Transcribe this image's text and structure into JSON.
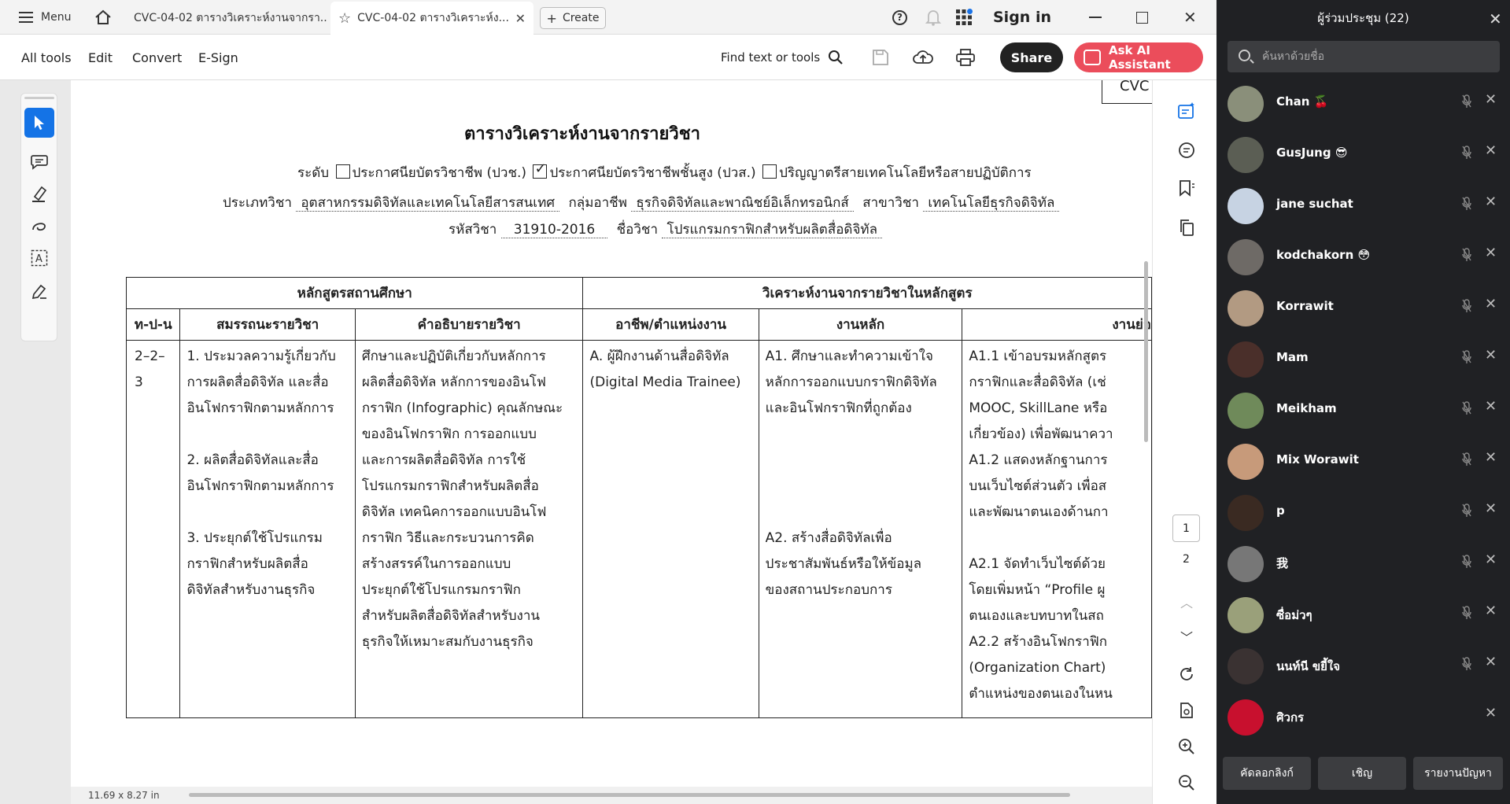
{
  "tabbar": {
    "menu_label": "Menu",
    "tabs": [
      {
        "label": "CVC-04-02 ตารางวิเคราะห์งานจากรา..."
      },
      {
        "label": "CVC-04-02 ตารางวิเคราะห์ง..."
      }
    ],
    "create_label": "Create",
    "sign_in_label": "Sign in"
  },
  "toolbar": {
    "all_tools": "All tools",
    "edit": "Edit",
    "convert": "Convert",
    "esign": "E-Sign",
    "find_label": "Find text or tools",
    "share_label": "Share",
    "ai_label": "Ask AI Assistant"
  },
  "document": {
    "corner_label": "CVC",
    "title": "ตารางวิเคราะห์งานจากรายวิชา",
    "level_label": "ระดับ",
    "level_options": [
      {
        "label": "ประกาศนียบัตรวิชาชีพ (ปวช.)",
        "checked": false
      },
      {
        "label": "ประกาศนียบัตรวิชาชีพชั้นสูง (ปวส.)",
        "checked": true
      },
      {
        "label": "ปริญญาตรีสายเทคโนโลยีหรือสายปฏิบัติการ",
        "checked": false
      }
    ],
    "type_label": "ประเภทวิชา",
    "type_value": "อุตสาหกรรมดิจิทัลและเทคโนโลยีสารสนเทศ",
    "group_label": "กลุ่มอาชีพ",
    "group_value": "ธุรกิจดิจิทัลและพาณิชย์อิเล็กทรอนิกส์",
    "major_label": "สาขาวิชา",
    "major_value": "เทคโนโลยีธุรกิจดิจิทัล",
    "code_label": "รหัสวิชา",
    "code_value": "31910-2016",
    "subject_label": "ชื่อวิชา",
    "subject_value": "โปรแกรมกราฟิกสำหรับผลิตสื่อดิจิทัล",
    "table": {
      "group_left": "หลักสูตรสถานศึกษา",
      "group_right": "วิเคราะห์งานจากรายวิชาในหลักสูตร",
      "headers": [
        "ท-ป-น",
        "สมรรถนะรายวิชา",
        "คำอธิบายรายวิชา",
        "อาชีพ/ตำแหน่งงาน",
        "งานหลัก",
        "งานย่อ"
      ],
      "tpn": "2–2–3",
      "competencies": [
        [
          "1. ประมวลความรู้เกี่ยวกับ",
          "การผลิตสื่อดิจิทัล และสื่อ",
          "อินโฟกราฟิกตามหลักการ"
        ],
        [
          "2. ผลิตสื่อดิจิทัลและสื่อ",
          "อินโฟกราฟิกตามหลักการ"
        ],
        [
          "3. ประยุกต์ใช้โปรแกรม",
          "กราฟิกสำหรับผลิตสื่อ",
          "ดิจิทัลสำหรับงานธุรกิจ"
        ]
      ],
      "description": [
        "ศึกษาและปฏิบัติเกี่ยวกับหลักการ",
        "ผลิตสื่อดิจิทัล หลักการของอินโฟ",
        "กราฟิก (Infographic) คุณลักษณะ",
        "ของอินโฟกราฟิก การออกแบบ",
        "และการผลิตสื่อดิจิทัล การใช้",
        "โปรแกรมกราฟิกสำหรับผลิตสื่อ",
        "ดิจิทัล เทคนิคการออกแบบอินโฟ",
        "กราฟิก วิธีและกระบวนการคิด",
        "สร้างสรรค์ในการออกแบบ",
        "ประยุกต์ใช้โปรแกรมกราฟิก",
        "สำหรับผลิตสื่อดิจิทัลสำหรับงาน",
        "ธุรกิจให้เหมาะสมกับงานธุรกิจ"
      ],
      "occupation": [
        "A. ผู้ฝึกงานด้านสื่อดิจิทัล",
        "(Digital Media Trainee)"
      ],
      "main_tasks": [
        [
          "A1. ศึกษาและทำความเข้าใจ",
          "หลักการออกแบบกราฟิกดิจิทัล",
          "และอินโฟกราฟิกที่ถูกต้อง"
        ],
        [
          "A2. สร้างสื่อดิจิทัลเพื่อ",
          "ประชาสัมพันธ์หรือให้ข้อมูล",
          "ของสถานประกอบการ"
        ]
      ],
      "sub_tasks": [
        "A1.1 เข้าอบรมหลักสูตร",
        "กราฟิกและสื่อดิจิทัล (เช่",
        "MOOC, SkillLane หรือ",
        "เกี่ยวข้อง) เพื่อพัฒนาควา",
        "A1.2 แสดงหลักฐานการ",
        "บนเว็บไซต์ส่วนตัว เพื่อส",
        "และพัฒนาตนเองด้านกา",
        "",
        "A2.1 จัดทำเว็บไซต์ด้วย",
        "โดยเพิ่มหน้า “Profile ผู",
        "ตนเองและบทบาทในสถ",
        "A2.2 สร้างอินโฟกราฟิก",
        "(Organization Chart)",
        "ตำแหน่งของตนเองในหน"
      ]
    }
  },
  "pager": {
    "current": "1",
    "next": "2"
  },
  "status": {
    "page_size": "11.69 x 8.27 in"
  },
  "panel": {
    "title": "ผู้ร่วมประชุม (22)",
    "search_placeholder": "ค้นหาด้วยชื่อ",
    "participants": [
      {
        "name": "Chan 🍒",
        "muted": true,
        "avatar_color": "#8a8f7a"
      },
      {
        "name": "GusJung 😎",
        "muted": true,
        "avatar_color": "#5b5e54"
      },
      {
        "name": "jane suchat",
        "muted": true,
        "avatar_color": "#c7d3e3"
      },
      {
        "name": "kodchakorn 😳",
        "muted": true,
        "avatar_color": "#6e6a66"
      },
      {
        "name": "Korrawit",
        "muted": true,
        "avatar_color": "#b29a82"
      },
      {
        "name": "Mam",
        "muted": true,
        "avatar_color": "#4a2f2a"
      },
      {
        "name": "Meikham",
        "muted": true,
        "avatar_color": "#6f8a5a"
      },
      {
        "name": "Mix Worawit",
        "muted": true,
        "avatar_color": "#c79a7a"
      },
      {
        "name": "p",
        "muted": true,
        "avatar_color": "#3a2a22"
      },
      {
        "name": "我",
        "muted": true,
        "avatar_color": "#777777"
      },
      {
        "name": "ซื่อม่วๆ",
        "muted": true,
        "avatar_color": "#9aa07a"
      },
      {
        "name": "นนท์นี ขยี้ใจ",
        "muted": true,
        "avatar_color": "#3a3232"
      },
      {
        "name": "ศิวกร",
        "muted": false,
        "avatar_color": "#c8102e"
      }
    ],
    "footer": {
      "copy_link": "คัดลอกลิงก์",
      "invite": "เชิญ",
      "report": "รายงานปัญหา"
    }
  }
}
